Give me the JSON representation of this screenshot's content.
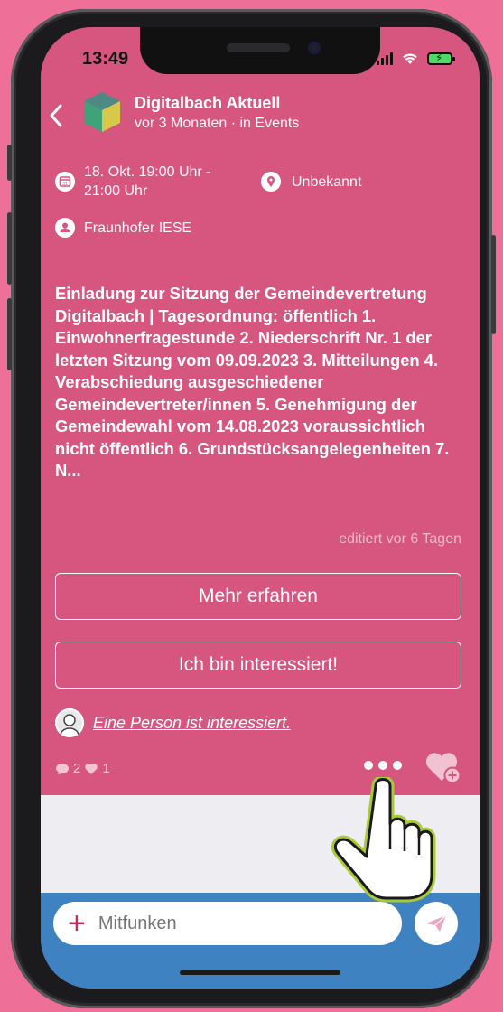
{
  "status_bar": {
    "time": "13:49"
  },
  "header": {
    "back_icon": "chevron-left-icon",
    "title": "Digitalbach Aktuell",
    "subtitle": "vor 3 Monaten · in Events"
  },
  "event": {
    "date_line1": "18. Okt. 19:00 Uhr -",
    "date_line2": "21:00 Uhr",
    "location": "Unbekannt",
    "organizer": "Fraunhofer IESE",
    "body": "Einladung zur Sitzung der Gemeindevertretung Digitalbach | Tagesordnung: öffentlich 1. Einwohnerfragestunde 2. Niederschrift Nr. 1 der letzten Sitzung vom 09.09.2023 3. Mitteilungen 4. Verabschiedung ausgeschiedener Gemeindevertreter/innen 5. Genehmigung der Gemeindewahl vom 14.08.2023 voraussichtlich nicht öffentlich 6. Grundstücksangelegenheiten 7. N...",
    "edited": "editiert vor 6 Tagen"
  },
  "actions": {
    "more_label": "Mehr erfahren",
    "interested_label": "Ich bin interessiert!"
  },
  "interested": {
    "text": "Eine Person ist interessiert."
  },
  "stats": {
    "comments": "2",
    "likes": "1"
  },
  "composer": {
    "placeholder": "Mitfunken"
  },
  "colors": {
    "background": "#ee6f97",
    "card": "#d6567f",
    "bottom_bar": "#3e82c1",
    "accent_plus": "#c52d5a"
  }
}
